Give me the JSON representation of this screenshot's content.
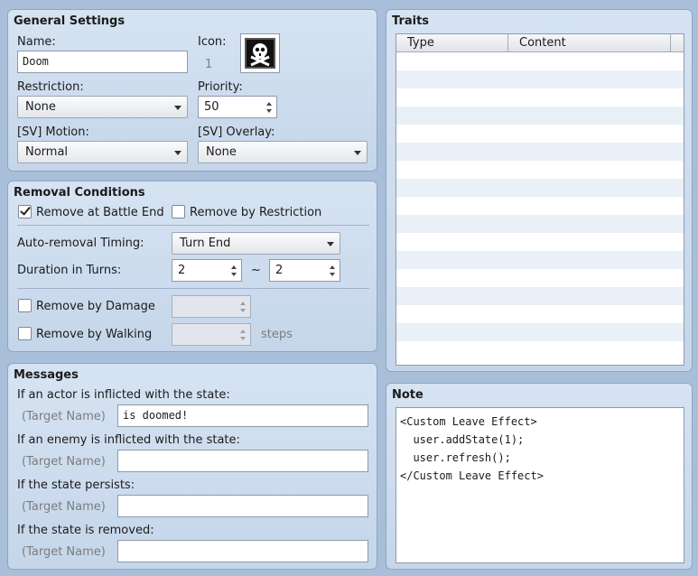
{
  "general": {
    "title": "General Settings",
    "name_label": "Name:",
    "name_value": "Doom",
    "icon_label": "Icon:",
    "icon_index": "1",
    "icon_name": "skull-crossbones-icon",
    "restriction_label": "Restriction:",
    "restriction_value": "None",
    "priority_label": "Priority:",
    "priority_value": "50",
    "sv_motion_label": "[SV] Motion:",
    "sv_motion_value": "Normal",
    "sv_overlay_label": "[SV] Overlay:",
    "sv_overlay_value": "None"
  },
  "removal": {
    "title": "Removal Conditions",
    "battle_end_label": "Remove at Battle End",
    "battle_end_checked": true,
    "restriction_label": "Remove by Restriction",
    "restriction_checked": false,
    "timing_label": "Auto-removal Timing:",
    "timing_value": "Turn End",
    "duration_label": "Duration in Turns:",
    "duration_min": "2",
    "duration_tilde": "~",
    "duration_max": "2",
    "damage_label": "Remove by Damage",
    "damage_checked": false,
    "damage_value": "",
    "walking_label": "Remove by Walking",
    "walking_checked": false,
    "walking_value": "",
    "steps_label": "steps"
  },
  "messages": {
    "title": "Messages",
    "target_placeholder": "(Target Name)",
    "items": [
      {
        "label": "If an actor is inflicted with the state:",
        "value": " is doomed!"
      },
      {
        "label": "If an enemy is inflicted with the state:",
        "value": ""
      },
      {
        "label": "If the state persists:",
        "value": ""
      },
      {
        "label": "If the state is removed:",
        "value": ""
      }
    ]
  },
  "traits": {
    "title": "Traits",
    "columns": [
      "Type",
      "Content"
    ],
    "rows": []
  },
  "note": {
    "title": "Note",
    "text": "<Custom Leave Effect>\n  user.addState(1);\n  user.refresh();\n</Custom Leave Effect>"
  }
}
